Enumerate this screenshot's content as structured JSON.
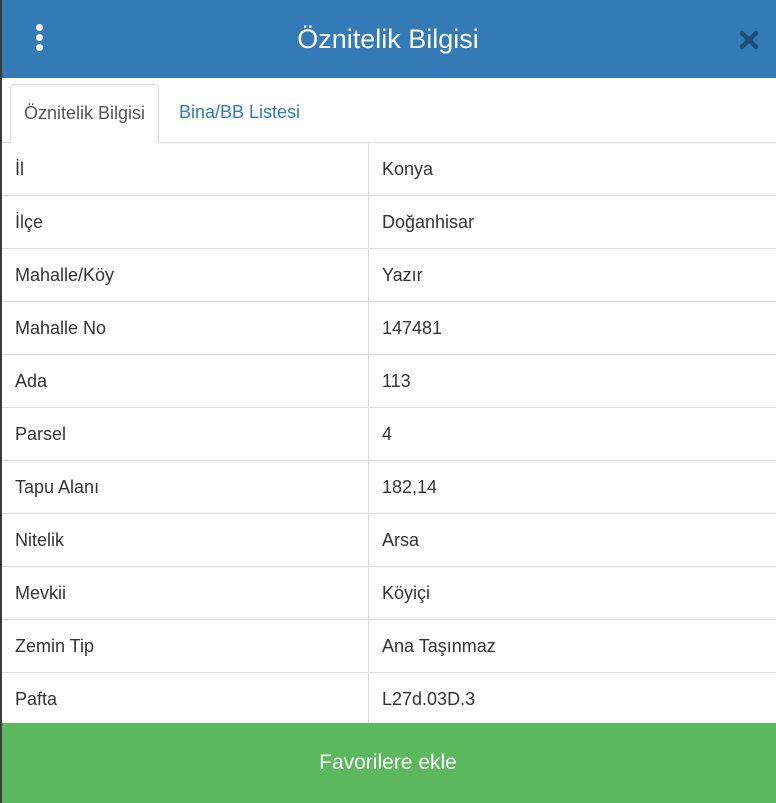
{
  "header": {
    "title": "Öznitelik Bilgisi",
    "menu_icon": "vertical-ellipsis-icon",
    "close_icon": "close-icon"
  },
  "tabs": [
    {
      "label": "Öznitelik Bilgisi",
      "active": true
    },
    {
      "label": "Bina/BB Listesi",
      "active": false
    }
  ],
  "attributes": [
    {
      "key": "İl",
      "value": "Konya"
    },
    {
      "key": "İlçe",
      "value": "Doğanhisar"
    },
    {
      "key": "Mahalle/Köy",
      "value": "Yazır"
    },
    {
      "key": "Mahalle No",
      "value": "147481"
    },
    {
      "key": "Ada",
      "value": "113"
    },
    {
      "key": "Parsel",
      "value": "4"
    },
    {
      "key": "Tapu Alanı",
      "value": "182,14"
    },
    {
      "key": "Nitelik",
      "value": "Arsa"
    },
    {
      "key": "Mevkii",
      "value": "Köyiçi"
    },
    {
      "key": "Zemin Tip",
      "value": "Ana Taşınmaz"
    },
    {
      "key": "Pafta",
      "value": "L27d.03D.3"
    }
  ],
  "footer": {
    "favorite_label": "Favorilere ekle"
  },
  "colors": {
    "header_bg": "#337ab7",
    "tab_link": "#337ab7",
    "button_bg": "#5cb85c",
    "border": "#dddddd"
  }
}
